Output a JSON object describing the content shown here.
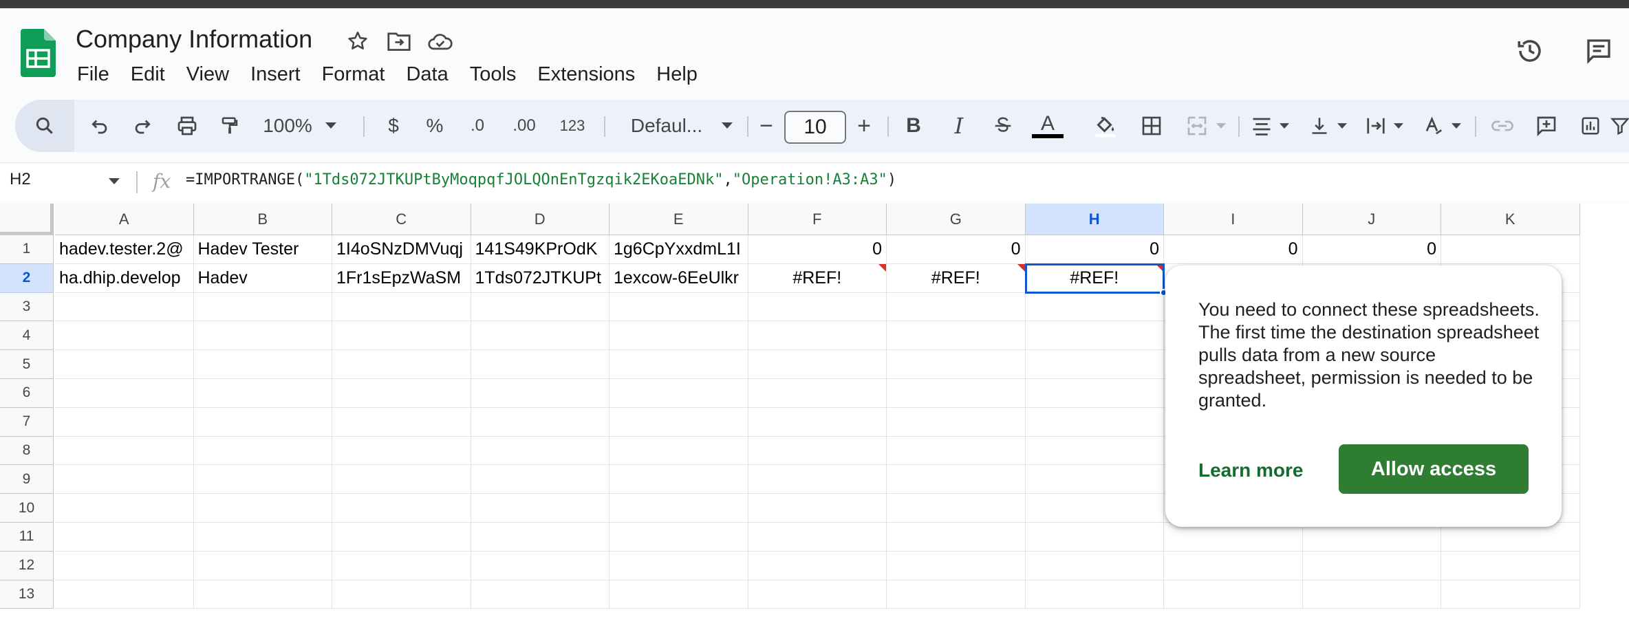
{
  "header": {
    "title": "Company Information",
    "menus": [
      "File",
      "Edit",
      "View",
      "Insert",
      "Format",
      "Data",
      "Tools",
      "Extensions",
      "Help"
    ]
  },
  "toolbar": {
    "zoom": "100%",
    "currency": "$",
    "percent": "%",
    "decrease_decimal": ".0",
    "increase_decimal": ".00",
    "number_format": "123",
    "font": "Defaul...",
    "font_size": "10",
    "minus": "−",
    "plus": "+",
    "bold": "B",
    "italic": "I",
    "text_color": "A"
  },
  "formula_bar": {
    "cell_ref": "H2",
    "fx": "fx",
    "func": "=IMPORTRANGE(",
    "arg1": "\"1Tds072JTKUPtByMoqpqfJOLQOnEnTgzqik2EKoaEDNk\"",
    "comma": ",",
    "arg2": "\"Operation!A3:A3\"",
    "close": ")"
  },
  "columns": [
    "A",
    "B",
    "C",
    "D",
    "E",
    "F",
    "G",
    "H",
    "I",
    "J",
    "K"
  ],
  "rows": [
    "1",
    "2",
    "3",
    "4",
    "5",
    "6",
    "7",
    "8",
    "9",
    "10",
    "11",
    "12",
    "13"
  ],
  "cells": {
    "r1": [
      "hadev.tester.2@",
      "Hadev Tester",
      "1I4oSNzDMVuqj",
      "141S49KPrOdK",
      "1g6CpYxxdmL1I",
      "0",
      "0",
      "0",
      "0",
      "0",
      ""
    ],
    "r2": [
      "ha.dhip.develop",
      "Hadev",
      "1Fr1sEpzWaSM",
      "1Tds072JTKUPt",
      "1excow-6EeUlkr",
      "#REF!",
      "#REF!",
      "#REF!",
      "",
      "",
      ""
    ]
  },
  "selected": {
    "column": "H",
    "row": "2"
  },
  "popup": {
    "message": "You need to connect these spreadsheets. The first time the destination spreadsheet pulls data from a new source spreadsheet, permission is needed to be granted.",
    "learn_more": "Learn more",
    "allow_access": "Allow access"
  },
  "colors": {
    "accent": "#0b57d0",
    "allow_button": "#2f7d32",
    "error": "#d93025",
    "sheets_green": "#0f9d58"
  }
}
